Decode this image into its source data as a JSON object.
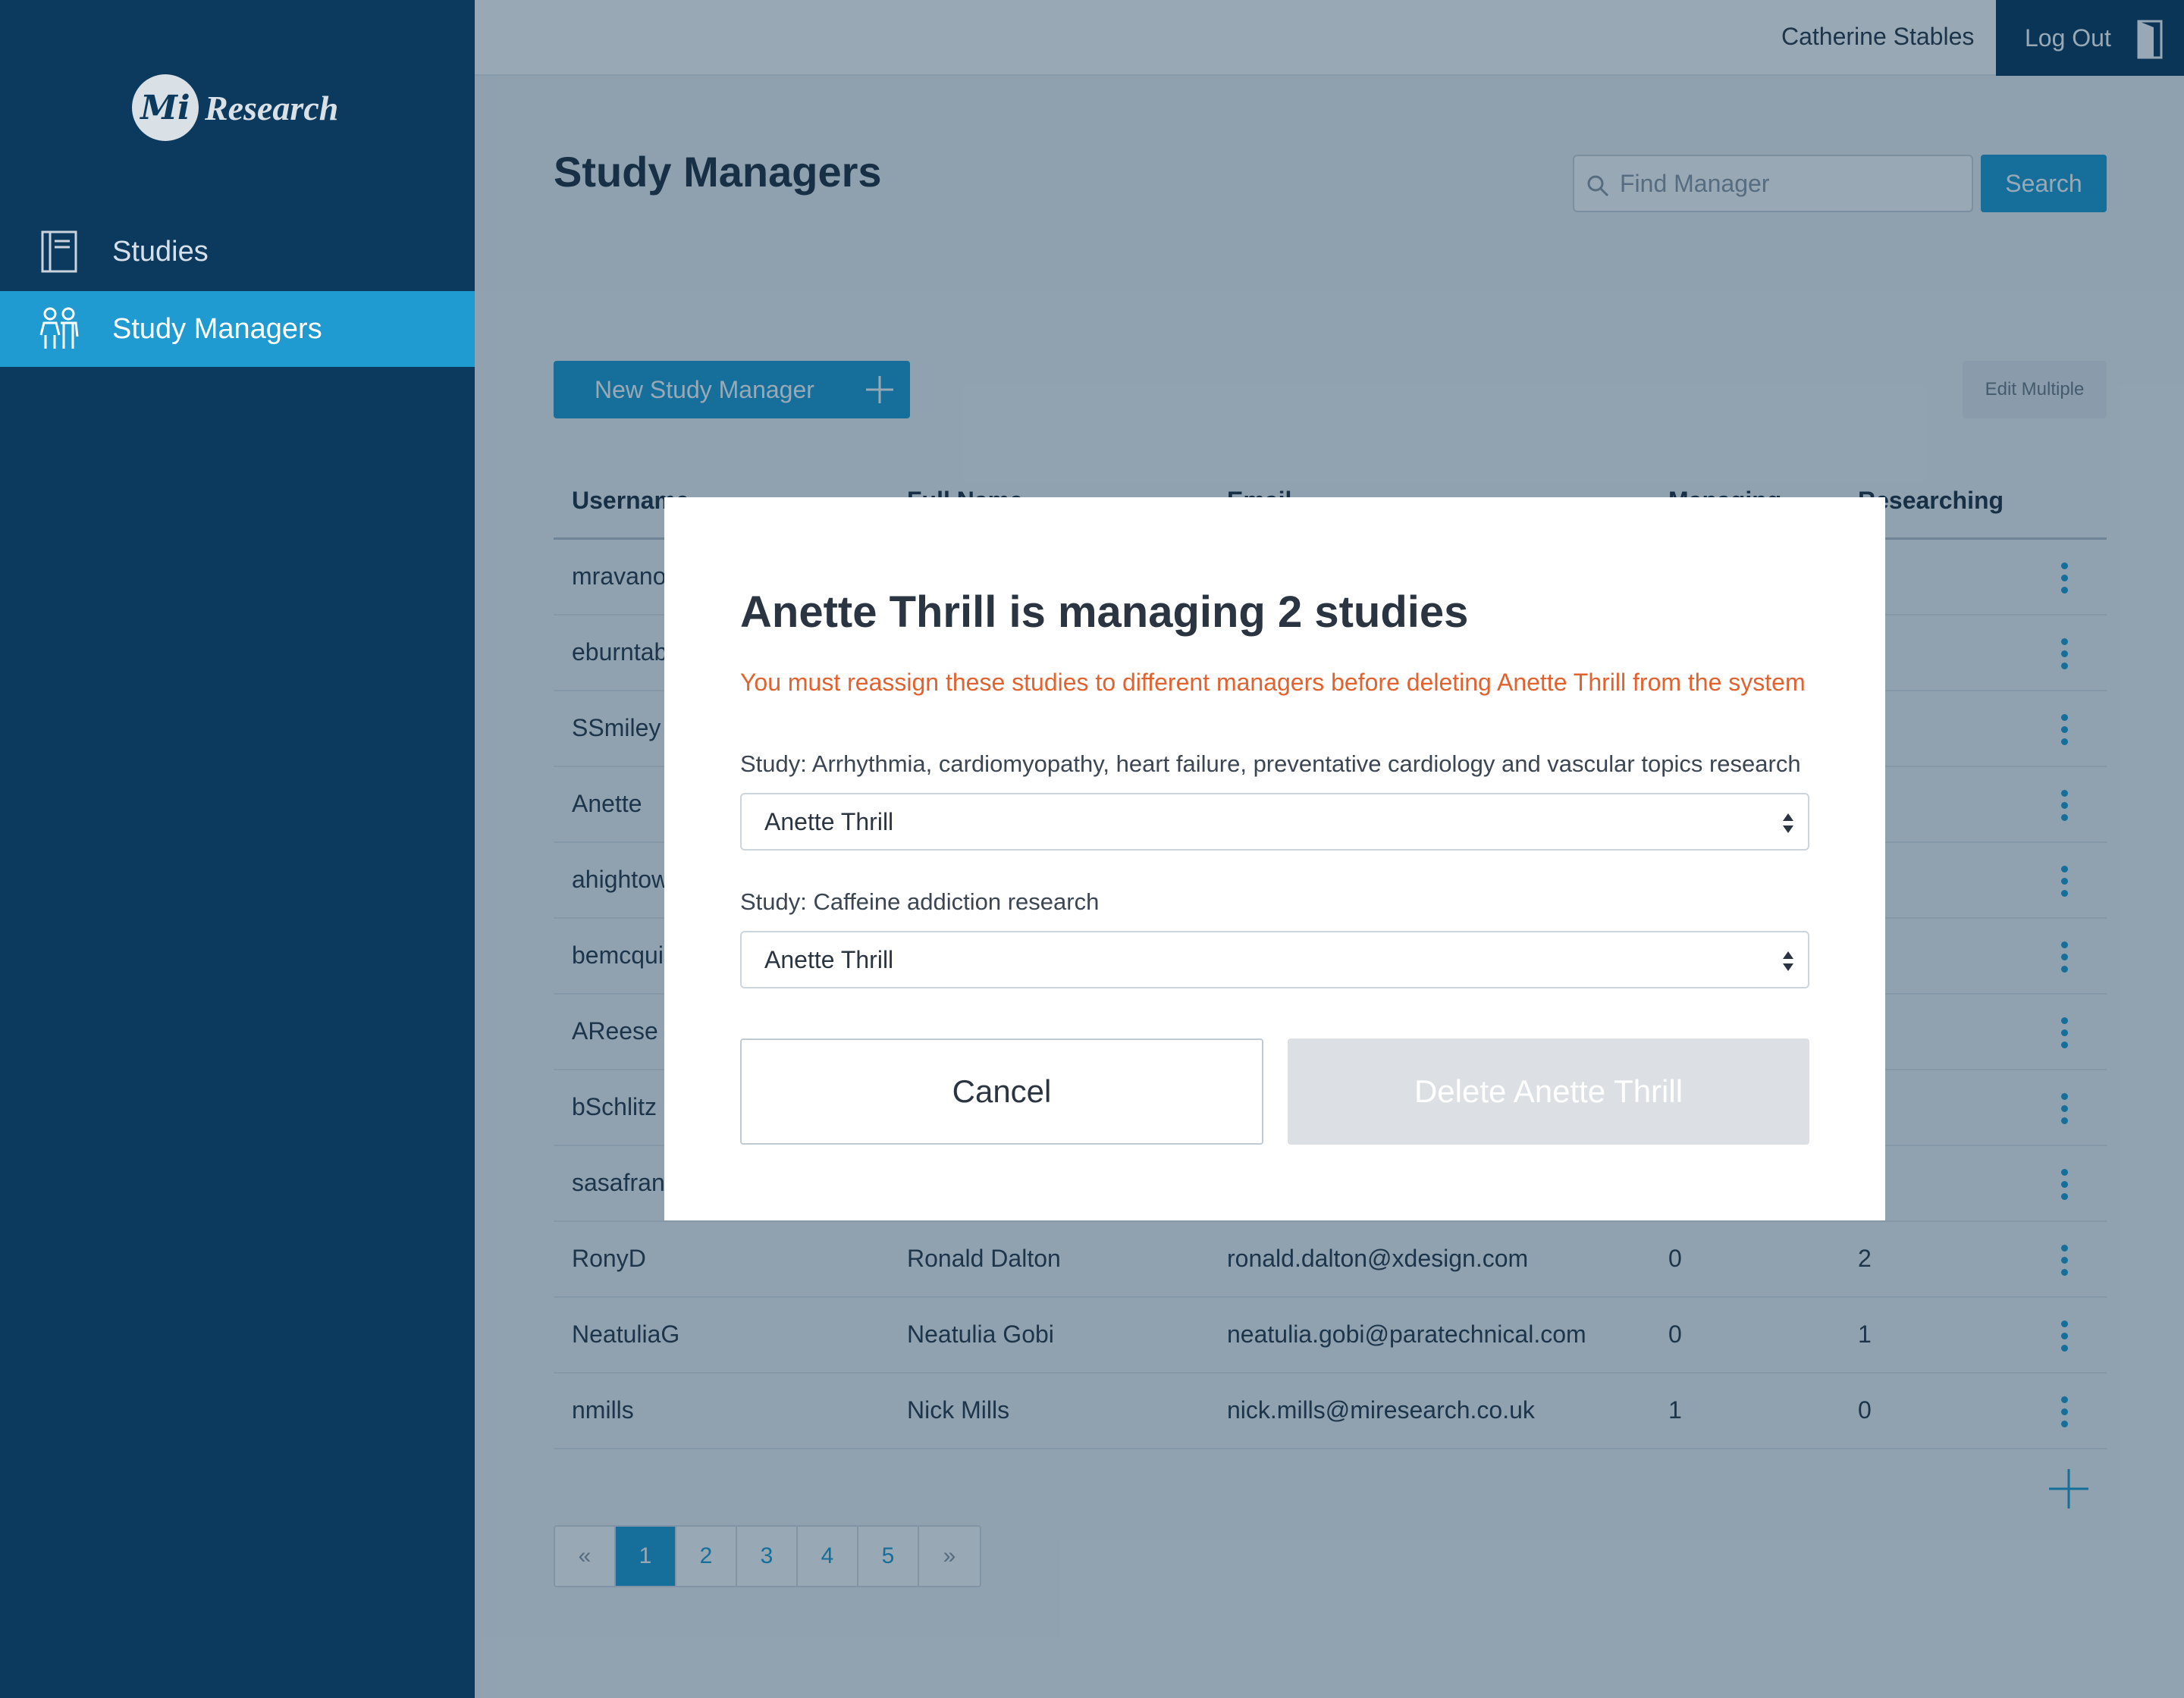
{
  "app": {
    "logo_mark": "Mi",
    "logo_text": "Research"
  },
  "sidebar": {
    "items": [
      {
        "label": "Studies",
        "icon": "book-icon",
        "active": false
      },
      {
        "label": "Study Managers",
        "icon": "people-icon",
        "active": true
      }
    ]
  },
  "topbar": {
    "user_name": "Catherine Stables",
    "logout_label": "Log Out",
    "logout_icon": "door-icon"
  },
  "header": {
    "title": "Study Managers",
    "search_placeholder": "Find Manager",
    "search_value": "",
    "search_button": "Search"
  },
  "actions": {
    "new_label": "New Study Manager",
    "edit_multiple_label": "Edit Multiple"
  },
  "table": {
    "columns": [
      "Username",
      "Full Name",
      "Email",
      "Managing",
      "Researching"
    ],
    "rows": [
      {
        "username": "mravanov",
        "full_name": "",
        "email": "",
        "managing": "",
        "researching": ""
      },
      {
        "username": "eburntab",
        "full_name": "",
        "email": "",
        "managing": "",
        "researching": ""
      },
      {
        "username": "SSmiley",
        "full_name": "",
        "email": "",
        "managing": "",
        "researching": ""
      },
      {
        "username": "Anette",
        "full_name": "",
        "email": "",
        "managing": "",
        "researching": ""
      },
      {
        "username": "ahightow",
        "full_name": "",
        "email": "",
        "managing": "",
        "researching": ""
      },
      {
        "username": "bemcquiston",
        "full_name": "",
        "email": "",
        "managing": "",
        "researching": ""
      },
      {
        "username": "AReese",
        "full_name": "",
        "email": "",
        "managing": "",
        "researching": ""
      },
      {
        "username": "bSchlitz",
        "full_name": "",
        "email": "",
        "managing": "",
        "researching": ""
      },
      {
        "username": "sasafran",
        "full_name": "",
        "email": "",
        "managing": "",
        "researching": ""
      },
      {
        "username": "RonyD",
        "full_name": "Ronald Dalton",
        "email": "ronald.dalton@xdesign.com",
        "managing": "0",
        "researching": "2"
      },
      {
        "username": "NeatuliaG",
        "full_name": "Neatulia Gobi",
        "email": "neatulia.gobi@paratechnical.com",
        "managing": "0",
        "researching": "1"
      },
      {
        "username": "nmills",
        "full_name": "Nick Mills",
        "email": "nick.mills@miresearch.co.uk",
        "managing": "1",
        "researching": "0"
      }
    ]
  },
  "pagination": {
    "prev": "«",
    "pages": [
      "1",
      "2",
      "3",
      "4",
      "5"
    ],
    "next": "»",
    "current": "1"
  },
  "modal": {
    "title": "Anette Thrill is managing 2 studies",
    "warning": "You must reassign these studies to different managers before deleting Anette Thrill from the system",
    "studies": [
      {
        "label": "Study: Arrhythmia, cardiomyopathy, heart failure, preventative cardiology and vascular topics research",
        "selected_manager": "Anette Thrill"
      },
      {
        "label": "Study: Caffeine addiction research",
        "selected_manager": "Anette Thrill"
      }
    ],
    "cancel_label": "Cancel",
    "delete_label": "Delete Anette Thrill"
  },
  "colors": {
    "sidebar": "#0b3a5e",
    "accent": "#1f9bd1",
    "warning": "#e2622f",
    "disabled": "#dcdfe3"
  }
}
